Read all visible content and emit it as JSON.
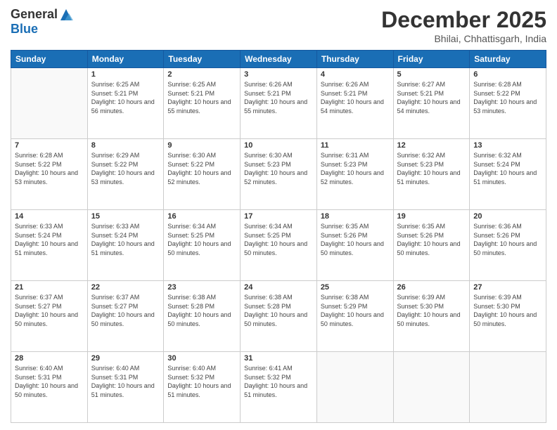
{
  "logo": {
    "general": "General",
    "blue": "Blue"
  },
  "header": {
    "month": "December 2025",
    "location": "Bhilai, Chhattisgarh, India"
  },
  "weekdays": [
    "Sunday",
    "Monday",
    "Tuesday",
    "Wednesday",
    "Thursday",
    "Friday",
    "Saturday"
  ],
  "weeks": [
    [
      {
        "day": "",
        "sunrise": "",
        "sunset": "",
        "daylight": ""
      },
      {
        "day": "1",
        "sunrise": "Sunrise: 6:25 AM",
        "sunset": "Sunset: 5:21 PM",
        "daylight": "Daylight: 10 hours and 56 minutes."
      },
      {
        "day": "2",
        "sunrise": "Sunrise: 6:25 AM",
        "sunset": "Sunset: 5:21 PM",
        "daylight": "Daylight: 10 hours and 55 minutes."
      },
      {
        "day": "3",
        "sunrise": "Sunrise: 6:26 AM",
        "sunset": "Sunset: 5:21 PM",
        "daylight": "Daylight: 10 hours and 55 minutes."
      },
      {
        "day": "4",
        "sunrise": "Sunrise: 6:26 AM",
        "sunset": "Sunset: 5:21 PM",
        "daylight": "Daylight: 10 hours and 54 minutes."
      },
      {
        "day": "5",
        "sunrise": "Sunrise: 6:27 AM",
        "sunset": "Sunset: 5:21 PM",
        "daylight": "Daylight: 10 hours and 54 minutes."
      },
      {
        "day": "6",
        "sunrise": "Sunrise: 6:28 AM",
        "sunset": "Sunset: 5:22 PM",
        "daylight": "Daylight: 10 hours and 53 minutes."
      }
    ],
    [
      {
        "day": "7",
        "sunrise": "Sunrise: 6:28 AM",
        "sunset": "Sunset: 5:22 PM",
        "daylight": "Daylight: 10 hours and 53 minutes."
      },
      {
        "day": "8",
        "sunrise": "Sunrise: 6:29 AM",
        "sunset": "Sunset: 5:22 PM",
        "daylight": "Daylight: 10 hours and 53 minutes."
      },
      {
        "day": "9",
        "sunrise": "Sunrise: 6:30 AM",
        "sunset": "Sunset: 5:22 PM",
        "daylight": "Daylight: 10 hours and 52 minutes."
      },
      {
        "day": "10",
        "sunrise": "Sunrise: 6:30 AM",
        "sunset": "Sunset: 5:23 PM",
        "daylight": "Daylight: 10 hours and 52 minutes."
      },
      {
        "day": "11",
        "sunrise": "Sunrise: 6:31 AM",
        "sunset": "Sunset: 5:23 PM",
        "daylight": "Daylight: 10 hours and 52 minutes."
      },
      {
        "day": "12",
        "sunrise": "Sunrise: 6:32 AM",
        "sunset": "Sunset: 5:23 PM",
        "daylight": "Daylight: 10 hours and 51 minutes."
      },
      {
        "day": "13",
        "sunrise": "Sunrise: 6:32 AM",
        "sunset": "Sunset: 5:24 PM",
        "daylight": "Daylight: 10 hours and 51 minutes."
      }
    ],
    [
      {
        "day": "14",
        "sunrise": "Sunrise: 6:33 AM",
        "sunset": "Sunset: 5:24 PM",
        "daylight": "Daylight: 10 hours and 51 minutes."
      },
      {
        "day": "15",
        "sunrise": "Sunrise: 6:33 AM",
        "sunset": "Sunset: 5:24 PM",
        "daylight": "Daylight: 10 hours and 51 minutes."
      },
      {
        "day": "16",
        "sunrise": "Sunrise: 6:34 AM",
        "sunset": "Sunset: 5:25 PM",
        "daylight": "Daylight: 10 hours and 50 minutes."
      },
      {
        "day": "17",
        "sunrise": "Sunrise: 6:34 AM",
        "sunset": "Sunset: 5:25 PM",
        "daylight": "Daylight: 10 hours and 50 minutes."
      },
      {
        "day": "18",
        "sunrise": "Sunrise: 6:35 AM",
        "sunset": "Sunset: 5:26 PM",
        "daylight": "Daylight: 10 hours and 50 minutes."
      },
      {
        "day": "19",
        "sunrise": "Sunrise: 6:35 AM",
        "sunset": "Sunset: 5:26 PM",
        "daylight": "Daylight: 10 hours and 50 minutes."
      },
      {
        "day": "20",
        "sunrise": "Sunrise: 6:36 AM",
        "sunset": "Sunset: 5:26 PM",
        "daylight": "Daylight: 10 hours and 50 minutes."
      }
    ],
    [
      {
        "day": "21",
        "sunrise": "Sunrise: 6:37 AM",
        "sunset": "Sunset: 5:27 PM",
        "daylight": "Daylight: 10 hours and 50 minutes."
      },
      {
        "day": "22",
        "sunrise": "Sunrise: 6:37 AM",
        "sunset": "Sunset: 5:27 PM",
        "daylight": "Daylight: 10 hours and 50 minutes."
      },
      {
        "day": "23",
        "sunrise": "Sunrise: 6:38 AM",
        "sunset": "Sunset: 5:28 PM",
        "daylight": "Daylight: 10 hours and 50 minutes."
      },
      {
        "day": "24",
        "sunrise": "Sunrise: 6:38 AM",
        "sunset": "Sunset: 5:28 PM",
        "daylight": "Daylight: 10 hours and 50 minutes."
      },
      {
        "day": "25",
        "sunrise": "Sunrise: 6:38 AM",
        "sunset": "Sunset: 5:29 PM",
        "daylight": "Daylight: 10 hours and 50 minutes."
      },
      {
        "day": "26",
        "sunrise": "Sunrise: 6:39 AM",
        "sunset": "Sunset: 5:30 PM",
        "daylight": "Daylight: 10 hours and 50 minutes."
      },
      {
        "day": "27",
        "sunrise": "Sunrise: 6:39 AM",
        "sunset": "Sunset: 5:30 PM",
        "daylight": "Daylight: 10 hours and 50 minutes."
      }
    ],
    [
      {
        "day": "28",
        "sunrise": "Sunrise: 6:40 AM",
        "sunset": "Sunset: 5:31 PM",
        "daylight": "Daylight: 10 hours and 50 minutes."
      },
      {
        "day": "29",
        "sunrise": "Sunrise: 6:40 AM",
        "sunset": "Sunset: 5:31 PM",
        "daylight": "Daylight: 10 hours and 51 minutes."
      },
      {
        "day": "30",
        "sunrise": "Sunrise: 6:40 AM",
        "sunset": "Sunset: 5:32 PM",
        "daylight": "Daylight: 10 hours and 51 minutes."
      },
      {
        "day": "31",
        "sunrise": "Sunrise: 6:41 AM",
        "sunset": "Sunset: 5:32 PM",
        "daylight": "Daylight: 10 hours and 51 minutes."
      },
      {
        "day": "",
        "sunrise": "",
        "sunset": "",
        "daylight": ""
      },
      {
        "day": "",
        "sunrise": "",
        "sunset": "",
        "daylight": ""
      },
      {
        "day": "",
        "sunrise": "",
        "sunset": "",
        "daylight": ""
      }
    ]
  ]
}
